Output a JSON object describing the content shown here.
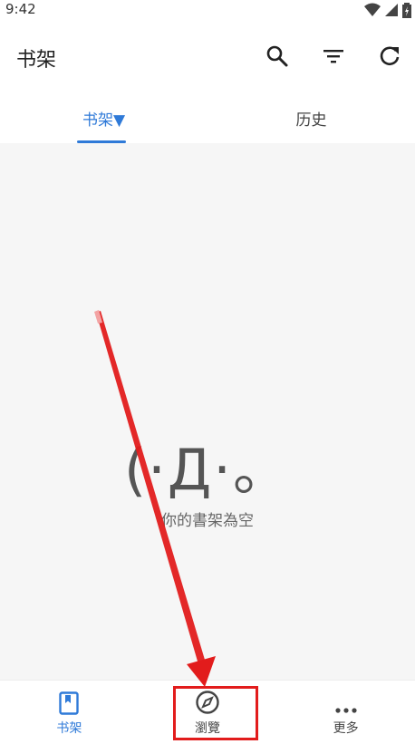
{
  "status_bar": {
    "time": "9:42"
  },
  "app_bar": {
    "title": "书架"
  },
  "icons": {
    "search": "search-icon",
    "filter": "filter-icon",
    "refresh": "refresh-icon",
    "bookshelf": "bookmark-book-icon",
    "browse": "compass-icon",
    "more": "more-dots-icon"
  },
  "tabs": [
    {
      "label": "书架▼",
      "active": true
    },
    {
      "label": "历史",
      "active": false
    }
  ],
  "empty_state": {
    "face": "(·Д·。",
    "message": "你的書架為空"
  },
  "bottom_nav": [
    {
      "label": "书架",
      "active": true
    },
    {
      "label": "瀏覽",
      "active": false
    },
    {
      "label": "更多",
      "active": false
    }
  ],
  "colors": {
    "accent": "#2f7ad8",
    "annotation": "#e21c1c",
    "content_bg": "#f6f6f6"
  }
}
